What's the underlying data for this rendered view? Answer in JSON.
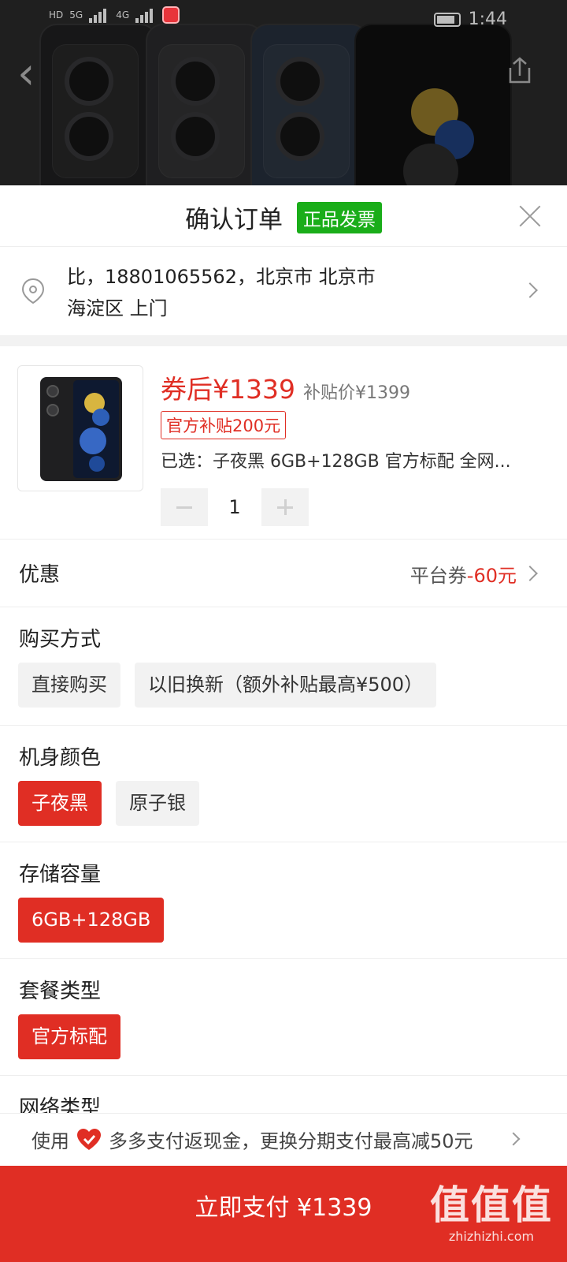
{
  "status_bar": {
    "time": "1:44",
    "network_left": "HD",
    "network_right": "5G",
    "network_4g": "4G"
  },
  "sheet": {
    "title": "确认订单",
    "title_badge": "正品发票"
  },
  "address": {
    "line1": "比，18801065562，北京市 北京市",
    "line2": "海淀区 上门"
  },
  "product": {
    "price_after_coupon": "券后¥1339",
    "subsidy_price": "补贴价¥1399",
    "subsidy_tag": "官方补贴200元",
    "selected": "已选：子夜黑 6GB+128GB 官方标配 全网...",
    "quantity": "1"
  },
  "discount": {
    "label": "优惠",
    "value_prefix": "平台券",
    "value_amount": "-60元"
  },
  "purchase_method": {
    "label": "购买方式",
    "options": [
      "直接购买",
      "以旧换新（额外补贴最高¥500）"
    ]
  },
  "color": {
    "label": "机身颜色",
    "options": [
      "子夜黑",
      "原子银"
    ],
    "selected_index": 0
  },
  "storage": {
    "label": "存储容量",
    "options": [
      "6GB+128GB"
    ],
    "selected_index": 0
  },
  "package": {
    "label": "套餐类型",
    "options": [
      "官方标配"
    ],
    "selected_index": 0
  },
  "network": {
    "label": "网络类型"
  },
  "promo": {
    "prefix": "使用",
    "text": "多多支付返现金，更换分期支付最高减50元"
  },
  "pay_button": {
    "label": "立即支付 ¥1339"
  },
  "watermark": {
    "big": "值值值",
    "small": "zhizhizhi.com"
  },
  "colors": {
    "accent": "#e02e24",
    "green_badge": "#1aad19"
  }
}
